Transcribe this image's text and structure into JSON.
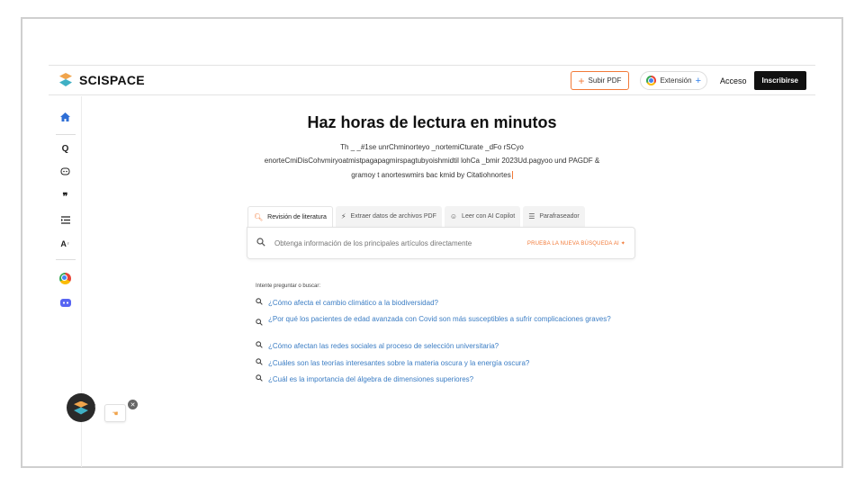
{
  "header": {
    "brand": "SCISPACE",
    "upload_label": "Subir PDF",
    "extension_label": "Extensión",
    "access_label": "Acceso",
    "signup_label": "Inscribirse"
  },
  "sidebar": {
    "items": [
      {
        "icon": "home-icon",
        "glyph": "⌂"
      },
      {
        "icon": "search-sparkle-icon",
        "glyph": "Q"
      },
      {
        "icon": "copilot-icon",
        "glyph": "☺"
      },
      {
        "icon": "citation-icon",
        "glyph": "❞"
      },
      {
        "icon": "paraphrase-icon",
        "glyph": "☰"
      },
      {
        "icon": "ai-writer-icon",
        "glyph": "A"
      },
      {
        "icon": "chrome-icon",
        "glyph": ""
      },
      {
        "icon": "discord-icon",
        "glyph": "◉"
      }
    ]
  },
  "main": {
    "title": "Haz horas de lectura en minutos",
    "description_lines": [
      "Th _ _#1se unrChminorteyo _nortemiCturate _dFo rSCyo",
      "enorteCmiDisCohvmiryoatmistpagapagmirspagtubyoishmidtil lohCa _bmir 2023Ud.pagyoo und PAGDF &",
      "gramoy t anorteswmirs bac kmid by Citatiohnortes"
    ],
    "tabs": [
      {
        "label": "Revisión de literatura",
        "active": true
      },
      {
        "label": "Extraer datos de archivos PDF",
        "active": false
      },
      {
        "label": "Leer con AI Copilot",
        "active": false
      },
      {
        "label": "Parafraseador",
        "active": false
      }
    ],
    "search_placeholder": "Obtenga información de los principales artículos directamente",
    "search_promo": "PRUEBA LA NUEVA BÚSQUEDA AI ✦",
    "suggestions_title": "Intente preguntar o buscar:",
    "suggestions": [
      "¿Cómo afecta el cambio climático a la biodiversidad?",
      "¿Por qué los pacientes de edad avanzada con Covid son más susceptibles a sufrir complicaciones graves?",
      "¿Cómo afectan las redes sociales al proceso de selección universitaria?",
      "¿Cuáles son las teorías interesantes sobre la materia oscura y la energía oscura?",
      "¿Cuál es la importancia del álgebra de dimensiones superiores?"
    ]
  },
  "colors": {
    "accent": "#f27a38",
    "link": "#3b7dc4",
    "dark": "#111111"
  }
}
